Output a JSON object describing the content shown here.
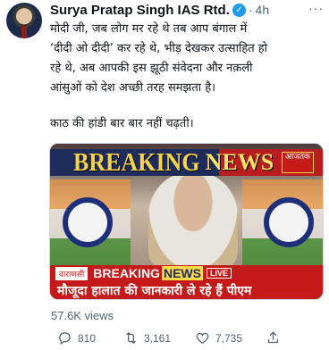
{
  "author": {
    "name": "Surya Pratap Singh IAS Rtd.",
    "verified_mark": "✓"
  },
  "meta": {
    "separator": "·",
    "time": "4h",
    "more": "···"
  },
  "body": {
    "lines": [
      "मोदी जी, जब लोग मर रहे थे तब आप बंगाल में",
      "‘दीदी ओ दीदी’ कर रहे थे, भीड़ देखकर उत्साहित हो",
      "रहे थे, अब आपकी इस झूठी संवेदना और नक़ली",
      "आंसुओं को देश अच्छी तरह समझता है।"
    ],
    "second": "काठ की हांडी बार बार नहीं चढ़ती।"
  },
  "media": {
    "banner_breaking": "BREAKING",
    "banner_news": "NEWS",
    "channel_logo": "आजतक",
    "ticker_location": "वाराणसी",
    "ticker_breaking": "BREAKING",
    "ticker_news": "NEWS",
    "ticker_live": "LIVE",
    "headline": "मौजूदा हालात की जानकारी ले रहे हैं पीएम"
  },
  "stats": {
    "views": "57.6K views"
  },
  "actions": {
    "replies": "810",
    "retweets": "3,161",
    "likes": "7,735"
  },
  "icons": [
    "reply-icon",
    "retweet-icon",
    "like-icon",
    "share-icon",
    "verified-icon",
    "more-icon"
  ],
  "colors": {
    "verified": "#1d9bf0",
    "muted": "#536471",
    "channel_red": "#c41a1a",
    "channel_navy": "#1d2c5a"
  }
}
